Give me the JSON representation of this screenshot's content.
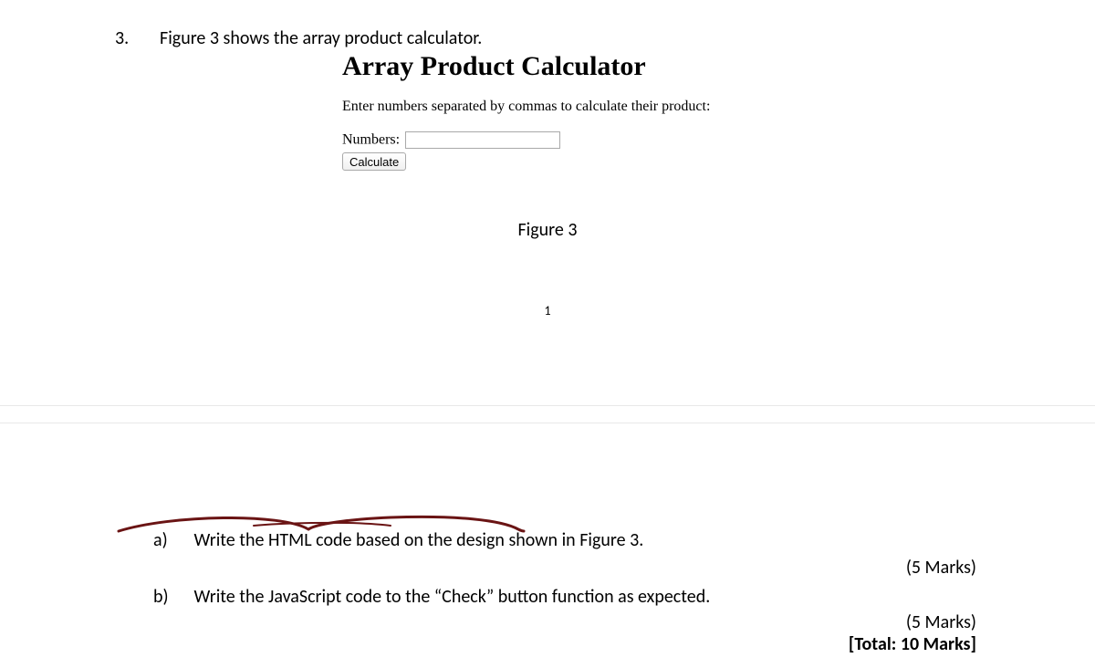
{
  "question": {
    "number": "3.",
    "text": "Figure 3 shows the array product calculator."
  },
  "figure": {
    "title": "Array Product Calculator",
    "description": "Enter numbers separated by commas to calculate their product:",
    "input_label": "Numbers:",
    "input_value": "",
    "button_label": "Calculate",
    "caption": "Figure 3"
  },
  "page_number": "1",
  "subparts": {
    "a": {
      "letter": "a)",
      "text": "Write the HTML code based on the design shown in Figure 3.",
      "marks": "(5 Marks)"
    },
    "b": {
      "letter": "b)",
      "text": "Write the JavaScript code to the “Check” button function as expected.",
      "marks": "(5 Marks)"
    },
    "total": "[Total: 10 Marks]"
  }
}
